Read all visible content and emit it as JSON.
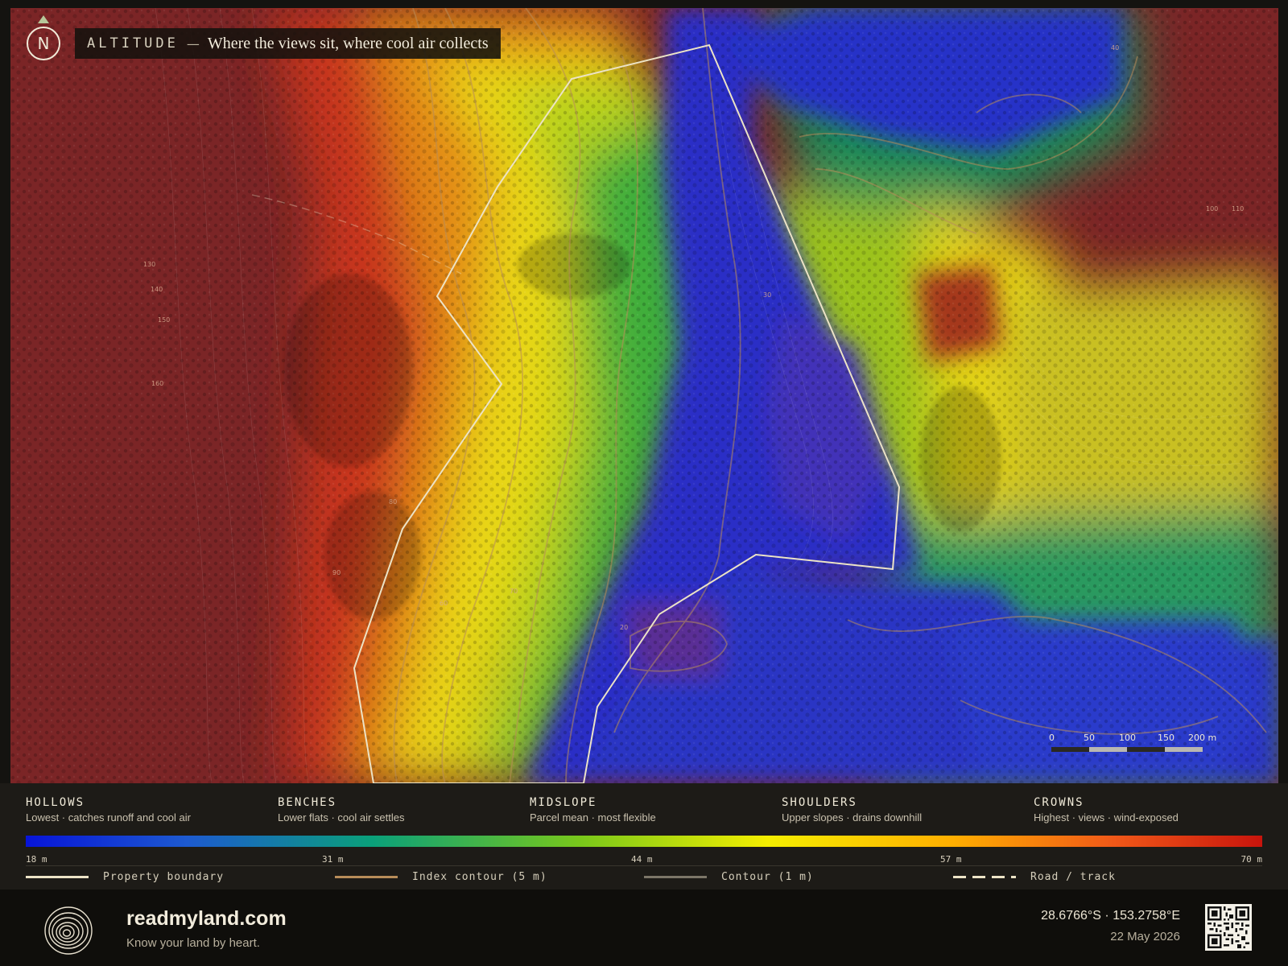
{
  "map": {
    "title_label": "ALTITUDE",
    "title_dash": "—",
    "title_text": "Where the views sit, where cool air collects",
    "north_label": "N",
    "contour_labels": [
      "130",
      "140",
      "150",
      "160",
      "80",
      "90",
      "30",
      "20",
      "100",
      "110",
      "40",
      "60",
      "70"
    ],
    "scale": {
      "labels": [
        "0",
        "50",
        "100",
        "150",
        "200 m"
      ]
    }
  },
  "legend": {
    "classes": [
      {
        "name": "HOLLOWS",
        "desc": "Lowest · catches runoff and cool air"
      },
      {
        "name": "BENCHES",
        "desc": "Lower flats · cool air settles"
      },
      {
        "name": "MIDSLOPE",
        "desc": "Parcel mean · most flexible"
      },
      {
        "name": "SHOULDERS",
        "desc": "Upper slopes · drains downhill"
      },
      {
        "name": "CROWNS",
        "desc": "Highest · views · wind-exposed"
      }
    ],
    "ticks": [
      "18 m",
      "31 m",
      "44 m",
      "57 m",
      "70 m"
    ],
    "keys": [
      {
        "label": "Property boundary",
        "color": "#ece3c6"
      },
      {
        "label": "Index contour (5 m)",
        "color": "#b88d59"
      },
      {
        "label": "Contour (1 m)",
        "color": "#7c7668"
      },
      {
        "label": "Road / track",
        "color": "#ece3c6"
      }
    ],
    "ramp_colors": [
      "#0714d8",
      "#0aa07a",
      "#f4ee00",
      "#ffae00",
      "#c8140c"
    ]
  },
  "footer": {
    "brand": "readmyland.com",
    "tagline": "Know your land by heart.",
    "coords": "28.6766°S · 153.2758°E",
    "date": "22 May 2026"
  }
}
